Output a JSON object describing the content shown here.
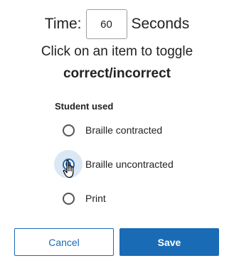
{
  "timer": {
    "label": "Time:",
    "value": "60",
    "unit": "Seconds"
  },
  "instructions": {
    "line1": "Click on an item to toggle",
    "line2": "correct/incorrect"
  },
  "student_used": {
    "label": "Student used",
    "selected_index": 1,
    "options": [
      {
        "label": "Braille contracted",
        "selected": false
      },
      {
        "label": "Braille uncontracted",
        "selected": true
      },
      {
        "label": "Print",
        "selected": false
      }
    ]
  },
  "actions": {
    "cancel_label": "Cancel",
    "save_label": "Save"
  },
  "colors": {
    "accent": "#1a6bb6",
    "focus_halo": "#dbe7f3",
    "text": "#222222"
  },
  "icons": {
    "cursor": "hand-pointer-icon"
  }
}
